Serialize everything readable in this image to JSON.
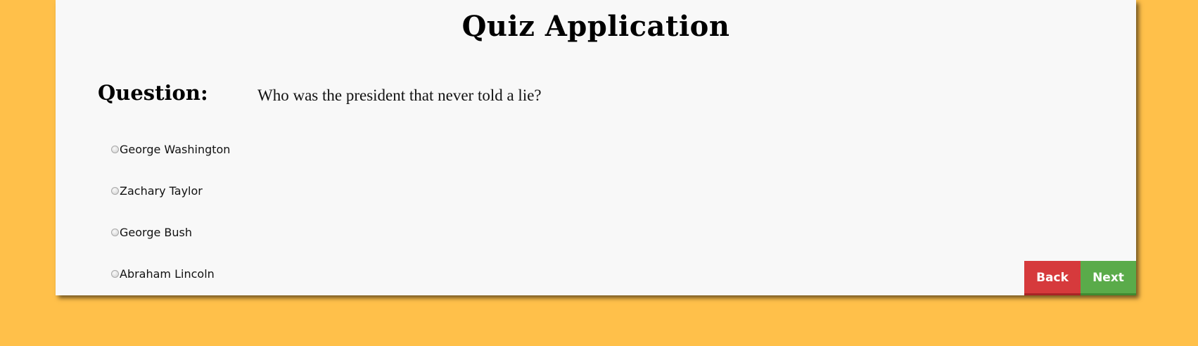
{
  "app": {
    "title": "Quiz Application"
  },
  "question": {
    "label": "Question:",
    "text": "Who was the president that never told a lie?"
  },
  "options": [
    {
      "label": "George Washington",
      "selected": false
    },
    {
      "label": "Zachary Taylor",
      "selected": false
    },
    {
      "label": "George Bush",
      "selected": false
    },
    {
      "label": "Abraham Lincoln",
      "selected": false
    }
  ],
  "buttons": {
    "back_label": "Back",
    "next_label": "Next"
  },
  "colors": {
    "background": "#ffc04a",
    "card": "#f8f8f8",
    "back_button": "#d63a3c",
    "next_button": "#5aab4a"
  }
}
